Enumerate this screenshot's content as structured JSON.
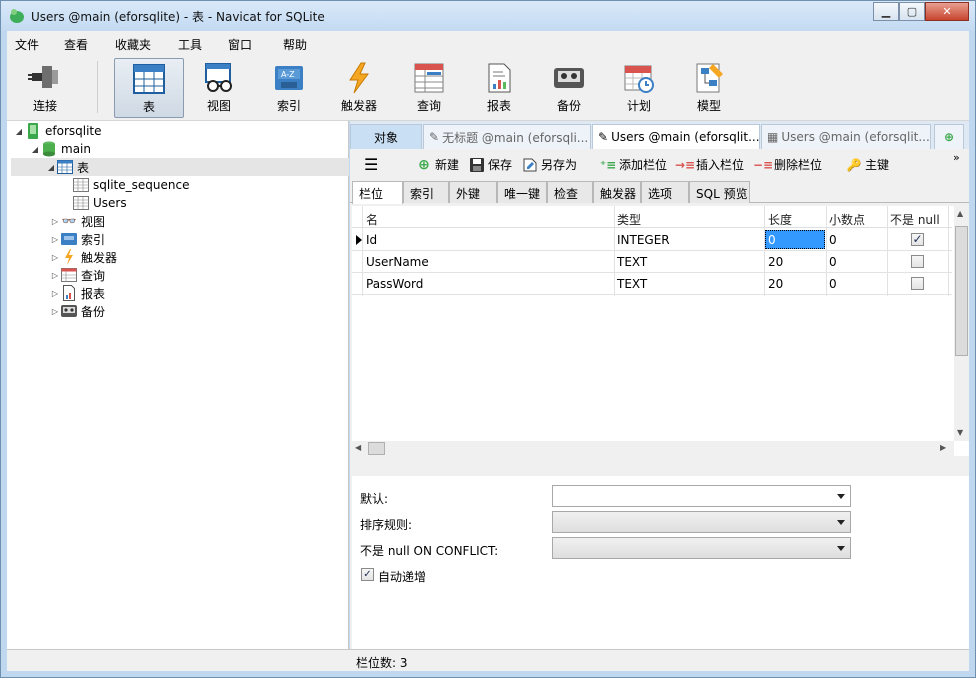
{
  "window": {
    "title": "Users @main (eforsqlite) - 表 - Navicat for SQLite"
  },
  "menu": [
    "文件",
    "查看",
    "收藏夹",
    "工具",
    "窗口",
    "帮助"
  ],
  "toolbar": [
    "连接",
    "表",
    "视图",
    "索引",
    "触发器",
    "查询",
    "报表",
    "备份",
    "计划",
    "模型"
  ],
  "tree": {
    "db": "eforsqlite",
    "schema": "main",
    "tables_node": "表",
    "tables": [
      "sqlite_sequence",
      "Users"
    ],
    "others": [
      "视图",
      "索引",
      "触发器",
      "查询",
      "报表",
      "备份"
    ]
  },
  "tabs": {
    "object": "对象",
    "t1": "无标题 @main (eforsqli...",
    "t2": "Users @main (eforsqlit...",
    "t3": "Users @main (eforsqlit..."
  },
  "subtoolbar": {
    "new": "新建",
    "save": "保存",
    "saveas": "另存为",
    "add_field": "添加栏位",
    "insert_field": "插入栏位",
    "delete_field": "删除栏位",
    "primary_key": "主键"
  },
  "field_tabs": [
    "栏位",
    "索引",
    "外键",
    "唯一键",
    "检查",
    "触发器",
    "选项",
    "SQL 预览"
  ],
  "grid": {
    "headers": {
      "name": "名",
      "type": "类型",
      "length": "长度",
      "decimal": "小数点",
      "notnull": "不是 null"
    },
    "rows": [
      {
        "name": "Id",
        "type": "INTEGER",
        "length": "0",
        "decimal": "0",
        "notnull": true
      },
      {
        "name": "UserName",
        "type": "TEXT",
        "length": "20",
        "decimal": "0",
        "notnull": false
      },
      {
        "name": "PassWord",
        "type": "TEXT",
        "length": "20",
        "decimal": "0",
        "notnull": false
      }
    ]
  },
  "props": {
    "default_label": "默认:",
    "collation_label": "排序规则:",
    "conflict_label": "不是 null ON CONFLICT:",
    "autoinc_label": "自动递增",
    "autoinc_checked": true
  },
  "status": {
    "field_count": "栏位数: 3"
  },
  "colors": {
    "accent": "#3399ff",
    "tab_active": "#c9dff3"
  }
}
